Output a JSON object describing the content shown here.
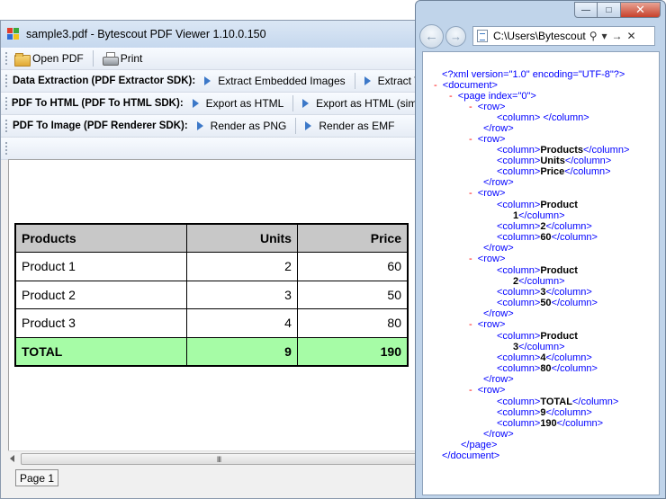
{
  "viewer": {
    "title": "sample3.pdf - Bytescout PDF Viewer 1.10.0.150",
    "toolbar1": {
      "open_label": "Open PDF",
      "print_label": "Print"
    },
    "toolbar2": {
      "label": "Data Extraction (PDF Extractor SDK):",
      "btn1": "Extract Embedded Images",
      "btn2": "Extract T"
    },
    "toolbar3": {
      "label": "PDF To HTML (PDF To HTML SDK):",
      "btn1": "Export as HTML",
      "btn2": "Export as HTML (simp"
    },
    "toolbar4": {
      "label": "PDF To Image (PDF Renderer SDK):",
      "btn1": "Render as PNG",
      "btn2": "Render as EMF"
    },
    "table": {
      "headers": [
        "Products",
        "Units",
        "Price"
      ],
      "rows": [
        [
          "Product 1",
          "2",
          "60"
        ],
        [
          "Product 2",
          "3",
          "50"
        ],
        [
          "Product 3",
          "4",
          "80"
        ]
      ],
      "total": [
        "TOTAL",
        "9",
        "190"
      ]
    },
    "page_tab": "Page 1",
    "scroll_grip": "III"
  },
  "ie": {
    "controls": {
      "minimize": "—",
      "maximize": "□",
      "close": "✕"
    },
    "address": "C:\\Users\\Bytescout",
    "tools": {
      "search": "⚲",
      "dropdown": "▾",
      "go": "→",
      "stop": "✕"
    },
    "nav": {
      "back": "←",
      "forward": "→"
    },
    "xml": {
      "decl": "<?xml version=\"1.0\" encoding=\"UTF-8\"?>",
      "collapse": "-",
      "doc_open": "<document>",
      "page_open": "<page index=\"0\">",
      "row_open": "<row>",
      "row_close": "</row>",
      "col_open": "<column>",
      "col_close": "</column>",
      "empty_col": "<column> </column>",
      "page_close": "</page>",
      "doc_close": "</document>",
      "v_products": "Products",
      "v_units": "Units",
      "v_price": "Price",
      "v_product": "Product",
      "v_1": "1",
      "v_2": "2",
      "v_3": "3",
      "v_4": "4",
      "v_50": "50",
      "v_60": "60",
      "v_80": "80",
      "v_total": "TOTAL",
      "v_9": "9",
      "v_190": "190"
    }
  }
}
